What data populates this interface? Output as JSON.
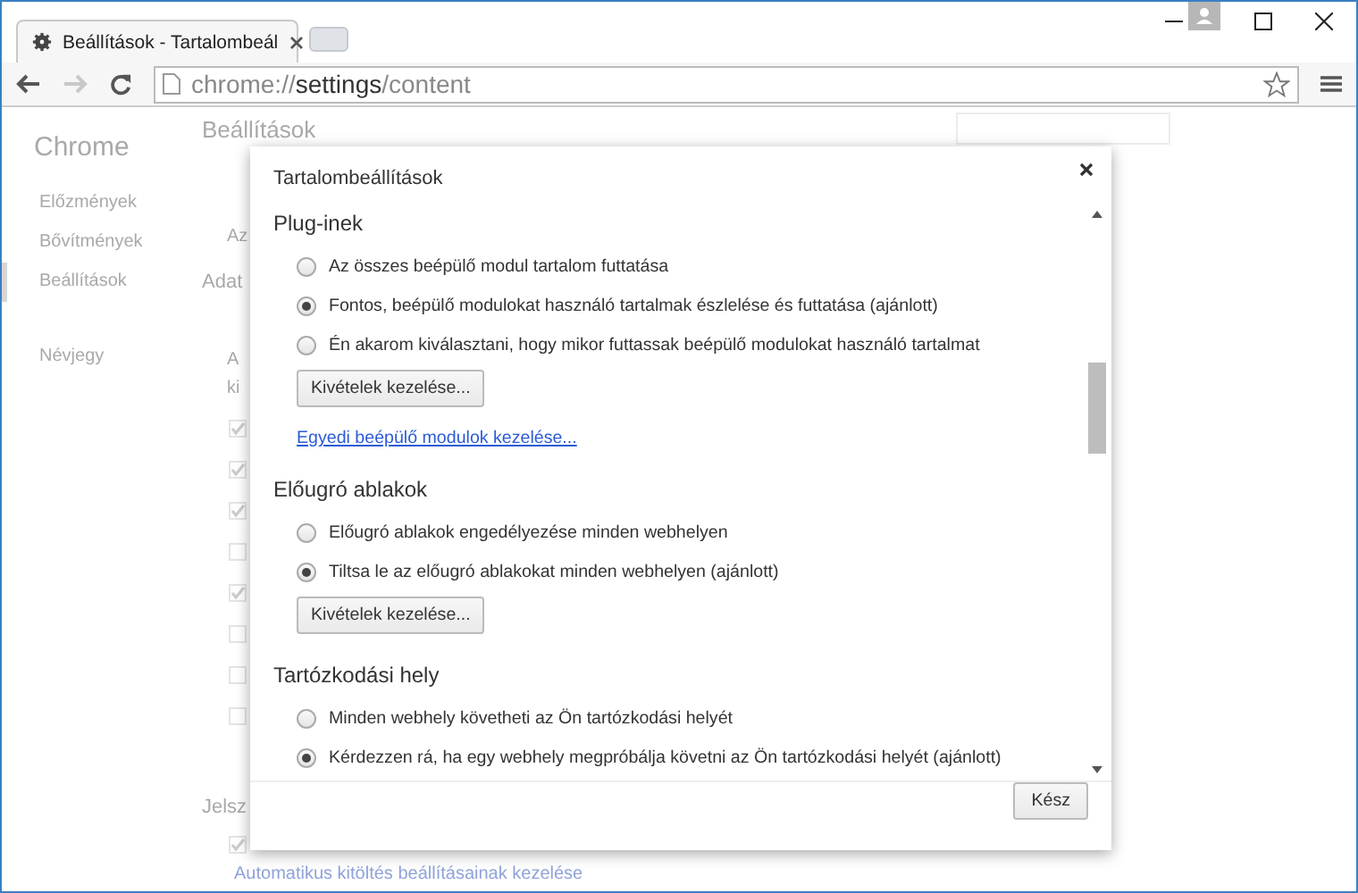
{
  "browser": {
    "tab_title": "Beállítások - Tartalombeál",
    "forward_disabled": true,
    "address": {
      "scheme": "chrome://",
      "host": "settings",
      "path": "/content"
    }
  },
  "page": {
    "brand": "Chrome",
    "sidebar": [
      {
        "label": "Előzmények",
        "selected": false
      },
      {
        "label": "Bővítmények",
        "selected": false
      },
      {
        "label": "Beállítások",
        "selected": true
      },
      {
        "label": "Névjegy",
        "selected": false
      }
    ],
    "heading": "Beállítások",
    "fragments": [
      "Az",
      "Adat",
      "A",
      "ki"
    ],
    "checkboxes": [
      {
        "checked": true
      },
      {
        "checked": true
      },
      {
        "checked": true
      },
      {
        "checked": false
      },
      {
        "checked": true
      },
      {
        "checked": false
      },
      {
        "checked": false
      },
      {
        "checked": false
      }
    ],
    "section_fragment": "Jelsz",
    "last_checkbox": {
      "checked": true
    },
    "link": "Automatikus kitöltés beállításainak kezelése"
  },
  "dialog": {
    "title": "Tartalombeállítások",
    "sections": [
      {
        "title": "Plug-inek",
        "options": [
          {
            "label": "Az összes beépülő modul tartalom futtatása",
            "selected": false
          },
          {
            "label": "Fontos, beépülő modulokat használó tartalmak észlelése és futtatása (ajánlott)",
            "selected": true
          },
          {
            "label": "Én akarom kiválasztani, hogy mikor futtassak beépülő modulokat használó tartalmat",
            "selected": false
          }
        ],
        "button": "Kivételek kezelése...",
        "link": "Egyedi beépülő modulok kezelése..."
      },
      {
        "title": "Előugró ablakok",
        "options": [
          {
            "label": "Előugró ablakok engedélyezése minden webhelyen",
            "selected": false
          },
          {
            "label": "Tiltsa le az előugró ablakokat minden webhelyen (ajánlott)",
            "selected": true
          }
        ],
        "button": "Kivételek kezelése..."
      },
      {
        "title": "Tartózkodási hely",
        "options": [
          {
            "label": "Minden webhely követheti az Ön tartózkodási helyét",
            "selected": false
          },
          {
            "label": "Kérdezzen rá, ha egy webhely megpróbálja követni az Ön tartózkodási helyét (ajánlott)",
            "selected": true
          }
        ]
      }
    ],
    "done": "Kész"
  }
}
